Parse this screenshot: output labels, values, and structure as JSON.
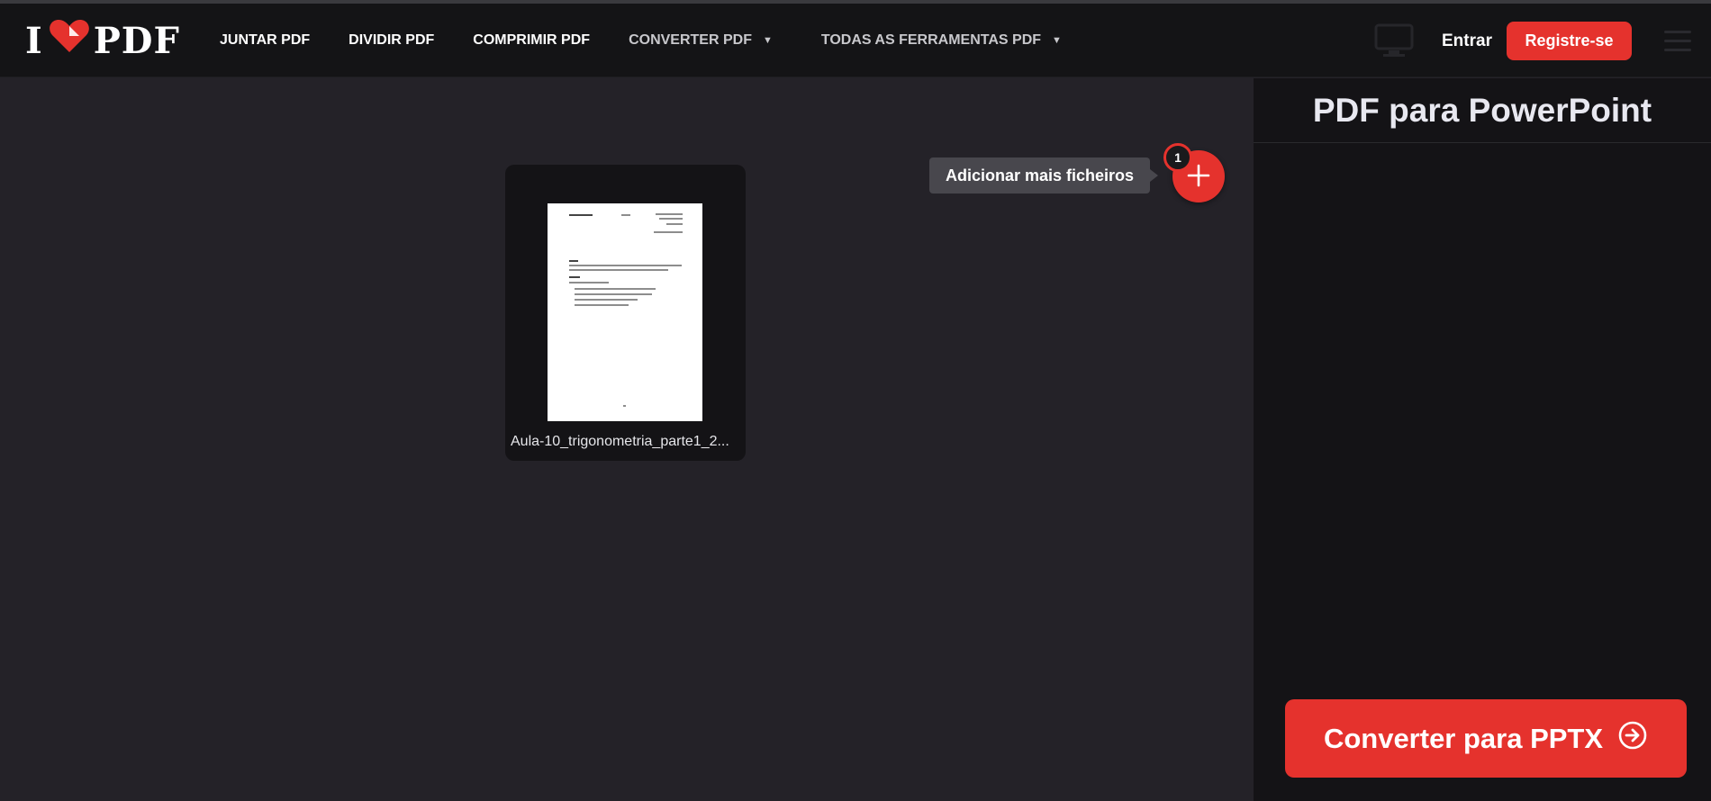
{
  "header": {
    "logo": {
      "left": "I",
      "right": "PDF"
    },
    "nav": [
      {
        "label": "JUNTAR PDF",
        "caret": false
      },
      {
        "label": "DIVIDIR PDF",
        "caret": false
      },
      {
        "label": "COMPRIMIR PDF",
        "caret": false
      },
      {
        "label": "CONVERTER PDF",
        "caret": true
      },
      {
        "label": "TODAS AS FERRAMENTAS PDF",
        "caret": true
      }
    ],
    "login_label": "Entrar",
    "register_label": "Registre-se"
  },
  "workspace": {
    "file": {
      "name": "Aula-10_trigonometria_parte1_2..."
    },
    "add_tooltip": "Adicionar mais ficheiros",
    "file_count": "1"
  },
  "sidebar": {
    "title": "PDF para PowerPoint",
    "convert_label": "Converter para PPTX"
  },
  "colors": {
    "accent": "#e5322d",
    "header_bg": "#141416",
    "workspace_bg": "#242228",
    "sidebar_bg": "#141316"
  }
}
